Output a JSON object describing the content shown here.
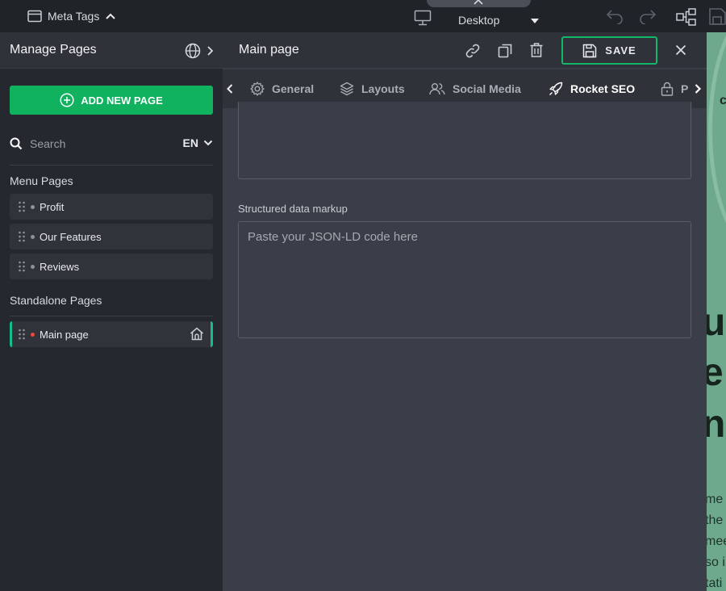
{
  "topbar": {
    "meta_tags_label": "Meta Tags",
    "device_label": "Desktop"
  },
  "left_panel": {
    "title": "Manage Pages",
    "add_button_label": "ADD NEW PAGE",
    "search_placeholder": "Search",
    "language": "EN",
    "menu_section_label": "Menu Pages",
    "menu_pages": [
      {
        "label": "Profit"
      },
      {
        "label": "Our Features"
      },
      {
        "label": "Reviews"
      }
    ],
    "standalone_section_label": "Standalone Pages",
    "standalone_pages": [
      {
        "label": "Main page",
        "active": true,
        "is_home": true
      }
    ]
  },
  "editor": {
    "title": "Main page",
    "save_label": "SAVE",
    "tabs": [
      {
        "label": "General",
        "icon": "gear-icon"
      },
      {
        "label": "Layouts",
        "icon": "layers-icon"
      },
      {
        "label": "Social Media",
        "icon": "users-icon"
      },
      {
        "label": "Rocket SEO",
        "icon": "rocket-icon",
        "active": true
      },
      {
        "label": "P",
        "icon": "lock-icon"
      }
    ],
    "structured_data_label": "Structured data markup",
    "structured_data_placeholder": "Paste your JSON-LD code here",
    "structured_data_value": ""
  },
  "preview": {
    "hero_chars": [
      "u",
      "e",
      "n"
    ],
    "para_chars": [
      "me",
      "the",
      "mee",
      "so i",
      "tati"
    ],
    "small_char": "c"
  },
  "colors": {
    "accent_green": "#10b25f",
    "active_tab_underline": "#14c08a",
    "active_page_dot": "#e84a3c",
    "preview_bg": "#6ea98e"
  }
}
